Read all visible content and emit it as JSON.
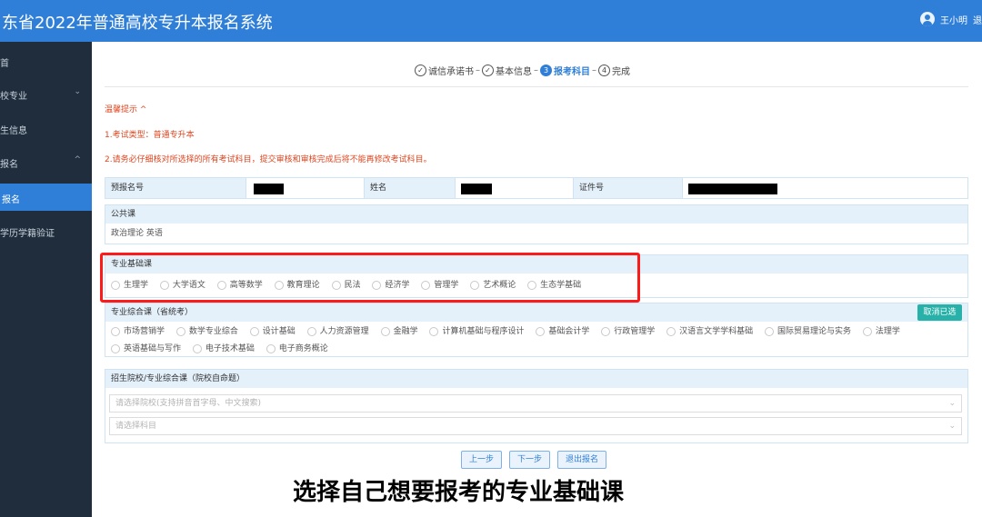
{
  "header": {
    "title": "东省2022年普通高校专升本报名系统",
    "user_name": "王小明",
    "logout": "退"
  },
  "sidebar": {
    "items": [
      {
        "label": "首"
      },
      {
        "label": "校专业"
      },
      {
        "label": "生信息"
      },
      {
        "label": "报名"
      },
      {
        "label": "报名"
      },
      {
        "label": "学历学籍验证"
      }
    ]
  },
  "steps": [
    {
      "num": "✓",
      "label": "诚信承诺书"
    },
    {
      "num": "✓",
      "label": "基本信息"
    },
    {
      "num": "3",
      "label": "报考科目"
    },
    {
      "num": "4",
      "label": "完成"
    }
  ],
  "notice": {
    "title": "温馨提示 ^",
    "line1": "1.考试类型：普通专升本",
    "line2": "2.请务必仔细核对所选择的所有考试科目，提交审核和审核完成后将不能再修改考试科目。"
  },
  "info": {
    "reg_label": "预报名号",
    "name_label": "姓名",
    "id_label": "证件号"
  },
  "public": {
    "title": "公共课",
    "subjects": "政治理论  英语"
  },
  "basic": {
    "title": "专业基础课",
    "options": [
      "生理学",
      "大学语文",
      "高等数学",
      "教育理论",
      "民法",
      "经济学",
      "管理学",
      "艺术概论",
      "生态学基础"
    ]
  },
  "comprehensive": {
    "title": "专业综合课（省统考）",
    "cancel_label": "取消已选",
    "options_row1": [
      "市场营销学",
      "数学专业综合",
      "设计基础",
      "人力资源管理",
      "金融学",
      "计算机基础与程序设计",
      "基础会计学",
      "行政管理学",
      "汉语言文学学科基础",
      "国际贸易理论与实务",
      "法理学"
    ],
    "options_row2": [
      "英语基础与写作",
      "电子技术基础",
      "电子商务概论"
    ]
  },
  "school": {
    "title": "招生院校/专业综合课（院校自命题）",
    "select1_placeholder": "请选择院校(支持拼音首字母、中文搜索)",
    "select2_placeholder": "请选择科目"
  },
  "buttons": {
    "prev": "上一步",
    "next": "下一步",
    "exit": "退出报名"
  },
  "caption": "选择自己想要报考的专业基础课",
  "colors": {
    "header": "#2f7fd8",
    "sidebar": "#1f2d3d",
    "highlight": "#ff1a1a",
    "notice": "#e0451f",
    "cancel_button": "#28b1a8"
  }
}
